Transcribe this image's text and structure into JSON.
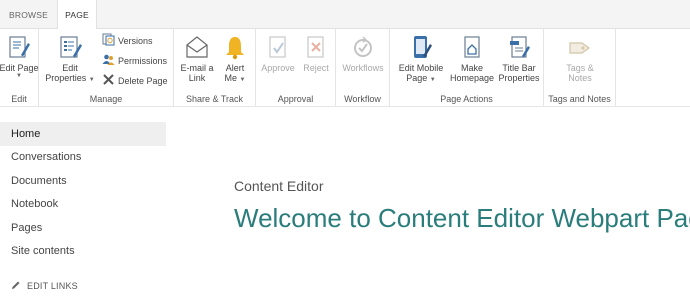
{
  "tabs": {
    "browse": "BROWSE",
    "page": "PAGE"
  },
  "ribbon": {
    "edit": {
      "edit_page": "Edit Page",
      "label": "Edit"
    },
    "manage": {
      "edit_properties_1": "Edit",
      "edit_properties_2": "Properties",
      "versions": "Versions",
      "permissions": "Permissions",
      "delete_page": "Delete Page",
      "label": "Manage"
    },
    "share": {
      "email_1": "E-mail a",
      "email_2": "Link",
      "alert_1": "Alert",
      "alert_2": "Me",
      "label": "Share & Track"
    },
    "approval": {
      "approve": "Approve",
      "reject": "Reject",
      "label": "Approval"
    },
    "workflow": {
      "workflows": "Workflows",
      "label": "Workflow"
    },
    "page_actions": {
      "edit_mobile_1": "Edit Mobile",
      "edit_mobile_2": "Page",
      "make_homepage_1": "Make",
      "make_homepage_2": "Homepage",
      "title_bar_1": "Title Bar",
      "title_bar_2": "Properties",
      "label": "Page Actions"
    },
    "tags": {
      "tags_1": "Tags &",
      "tags_2": "Notes",
      "label": "Tags and Notes"
    }
  },
  "nav": {
    "items": [
      "Home",
      "Conversations",
      "Documents",
      "Notebook",
      "Pages",
      "Site contents"
    ],
    "edit_links": "EDIT LINKS"
  },
  "content": {
    "webpart_title": "Content Editor",
    "welcome": "Welcome to Content Editor Webpart Page"
  },
  "colors": {
    "accent": "#2a7d7b",
    "icon_blue": "#3a6fa8",
    "bell": "#f0b323"
  }
}
